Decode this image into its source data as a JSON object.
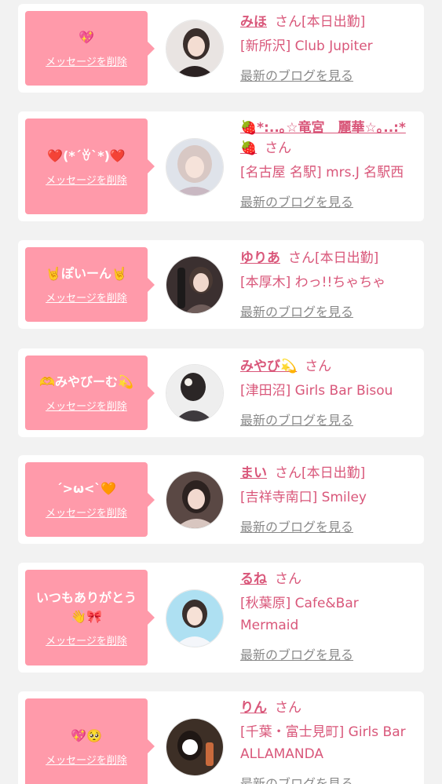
{
  "colors": {
    "bubble": "#ff9aaa",
    "accent": "#d9577a",
    "link_gray": "#8a8a8a",
    "background": "#f2f2f2"
  },
  "cards": [
    {
      "message": "💖",
      "delete_label": "メッセージを削除",
      "name": "みほ",
      "suffix": "さん",
      "status": "[本日出勤]",
      "shop": "[新所沢] Club Jupiter",
      "blog_label": "最新のブログを見る",
      "avatar_icon": "girl-photo-icon"
    },
    {
      "message": "❤️(*´ꈊ`*)❤️",
      "delete_label": "メッセージを削除",
      "name": "🍓*:..｡☆竜宮　麗華☆｡..:*🍓",
      "suffix": "さん",
      "status": "",
      "shop": "[名古屋 名駅] mrs.J 名駅西",
      "blog_label": "最新のブログを見る",
      "avatar_icon": "girl-photo-icon"
    },
    {
      "message": "🤘ぽいーん🤘",
      "delete_label": "メッセージを削除",
      "name": "ゆりあ",
      "suffix": "さん",
      "status": "[本日出勤]",
      "shop": "[本厚木] わっ!!ちゃちゃ",
      "blog_label": "最新のブログを見る",
      "avatar_icon": "girl-photo-icon"
    },
    {
      "message": "🫶みやびーむ💫",
      "delete_label": "メッセージを削除",
      "name": "みやび💫",
      "suffix": "さん",
      "status": "",
      "shop": "[津田沼] Girls Bar Bisou",
      "blog_label": "最新のブログを見る",
      "avatar_icon": "girl-photo-icon"
    },
    {
      "message": "´>ω<`🧡",
      "delete_label": "メッセージを削除",
      "name": "まい",
      "suffix": "さん",
      "status": "[本日出勤]",
      "shop": "[吉祥寺南口] Smiley",
      "blog_label": "最新のブログを見る",
      "avatar_icon": "girl-photo-icon"
    },
    {
      "message": "いつもありがとう👋🎀",
      "delete_label": "メッセージを削除",
      "name": "るね",
      "suffix": "さん",
      "status": "",
      "shop": "[秋葉原] Cafe&Bar Mermaid",
      "blog_label": "最新のブログを見る",
      "avatar_icon": "girl-photo-icon"
    },
    {
      "message": "💖🥺",
      "delete_label": "メッセージを削除",
      "name": "りん",
      "suffix": "さん",
      "status": "",
      "shop": "[千葉・富士見町] Girls Bar ALLAMANDA",
      "blog_label": "最新のブログを見る",
      "avatar_icon": "girl-photo-icon"
    }
  ]
}
